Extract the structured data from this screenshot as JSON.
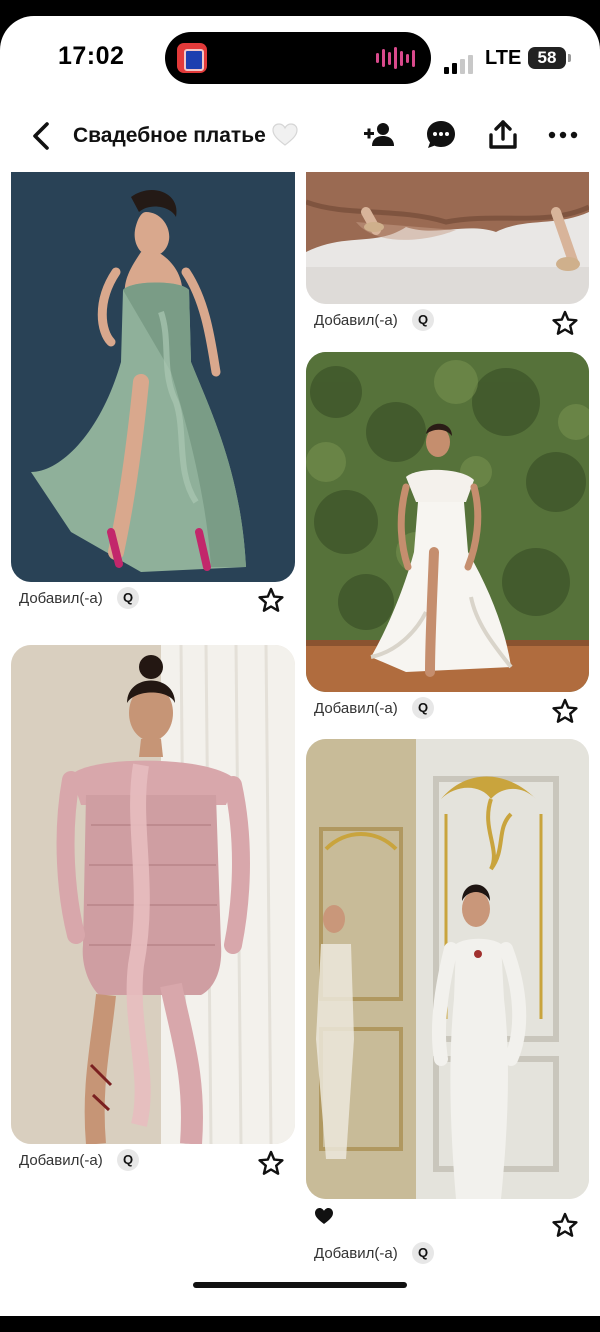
{
  "status_bar": {
    "time": "17:02",
    "network": "LTE",
    "battery": "58"
  },
  "header": {
    "title": "Свадебное платье",
    "icons": [
      "back-icon",
      "white-heart-icon",
      "add-collaborator-icon",
      "comment-icon",
      "share-icon",
      "more-icon"
    ]
  },
  "pins": [
    {
      "added_label": "Добавил(-а)",
      "user_initial": "Q",
      "image": "green ruffled satin gown, dark blue backdrop"
    },
    {
      "added_label": "Добавил(-а)",
      "user_initial": "Q",
      "image": "brown chiffon dress hem"
    },
    {
      "added_label": "Добавил(-а)",
      "user_initial": "Q",
      "image": "white off-shoulder ruffle dress, green hedge"
    },
    {
      "added_label": "Добавил(-а)",
      "user_initial": "Q",
      "image": "pink ruffled mini dress, window curtains"
    },
    {
      "added_label": "Добавил(-а)",
      "user_initial": "Q",
      "image": "white slip dress, ornate gilded wall",
      "heart": "black-heart-icon"
    }
  ],
  "colors": {
    "header_text": "#111111",
    "badge_bg": "#e7e7e7",
    "green_backdrop": "#2e4a60",
    "green_dress": "#8fb09a"
  }
}
